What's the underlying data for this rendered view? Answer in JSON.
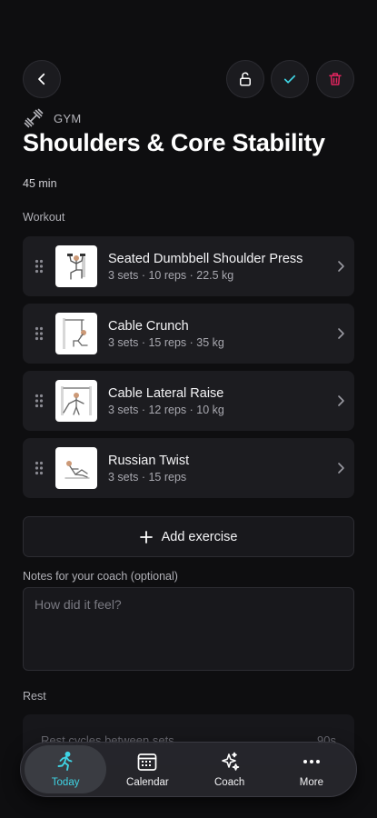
{
  "header": {
    "back_icon": "chevron-left-icon",
    "unlock_icon": "unlock-icon",
    "check_icon": "check-icon",
    "delete_icon": "trash-icon",
    "colors": {
      "check": "#3fd4e4",
      "delete": "#e0245e"
    }
  },
  "workout": {
    "category_icon": "dumbbell-icon",
    "category": "GYM",
    "title": "Shoulders & Core Stability",
    "duration": "45 min",
    "section_label": "Workout"
  },
  "exercises": [
    {
      "name": "Seated Dumbbell Shoulder Press",
      "meta": "3 sets · 10 reps · 22.5 kg"
    },
    {
      "name": "Cable Crunch",
      "meta": "3 sets · 15 reps · 35 kg"
    },
    {
      "name": "Cable Lateral Raise",
      "meta": "3 sets · 12 reps · 10 kg"
    },
    {
      "name": "Russian Twist",
      "meta": "3 sets · 15 reps"
    }
  ],
  "add_exercise": {
    "label": "Add exercise",
    "icon": "plus-icon"
  },
  "notes": {
    "label": "Notes for your coach (optional)",
    "placeholder": "How did it feel?",
    "value": ""
  },
  "rest": {
    "label": "Rest",
    "row_label": "Rest cycles between sets",
    "row_value": "90s"
  },
  "tabbar": {
    "tabs": [
      {
        "label": "Today",
        "icon": "running-person-icon",
        "active": true
      },
      {
        "label": "Calendar",
        "icon": "calendar-icon",
        "active": false
      },
      {
        "label": "Coach",
        "icon": "sparkles-icon",
        "active": false
      },
      {
        "label": "More",
        "icon": "more-dots-icon",
        "active": false
      }
    ],
    "active_color": "#3fd4e4"
  }
}
